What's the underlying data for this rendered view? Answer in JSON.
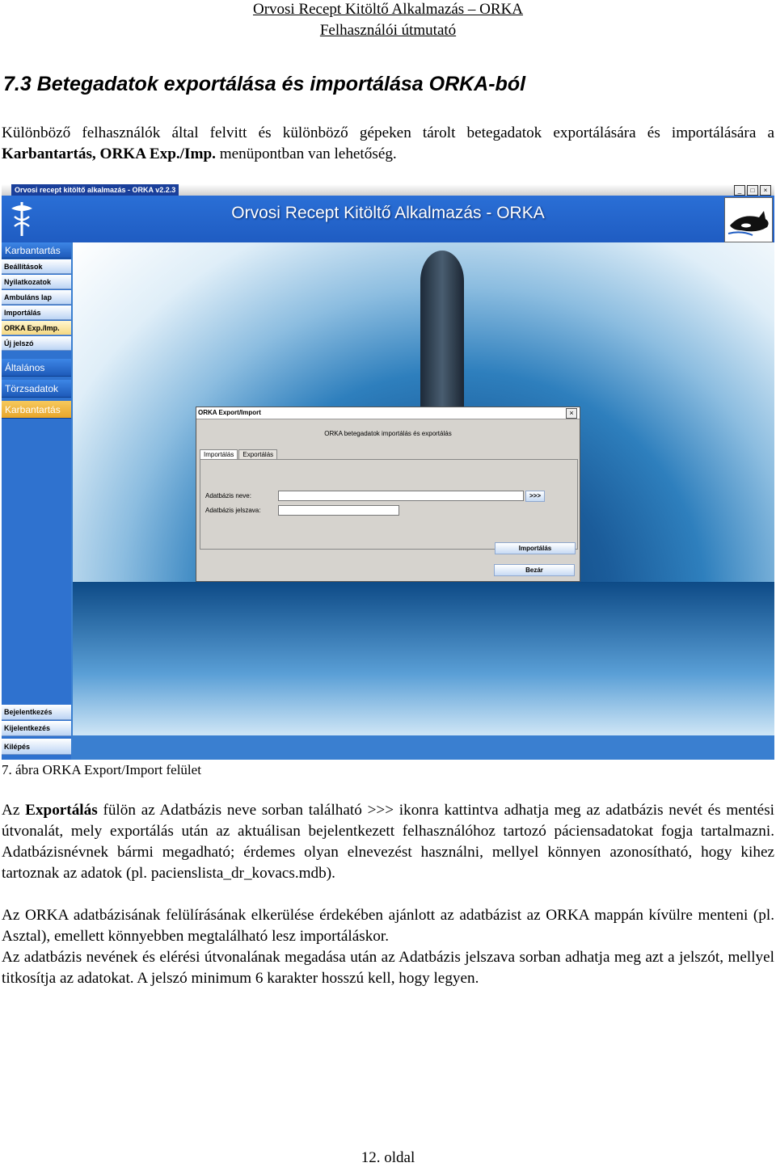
{
  "header": {
    "line1": "Orvosi Recept Kitöltő Alkalmazás – ORKA",
    "line2": "Felhasználói útmutató"
  },
  "section_title": "7.3 Betegadatok exportálása és importálása ORKA-ból",
  "intro": {
    "text_a": "Különböző felhasználók által felvitt és különböző gépeken tárolt betegadatok exportálására és importálására a ",
    "bold": "Karbantartás, ORKA Exp./Imp.",
    "text_b": " menüpontban van lehetőség."
  },
  "screenshot": {
    "window_title": "Orvosi recept kitöltő alkalmazás - ORKA v2.2.3",
    "window_buttons": [
      "_",
      "□",
      "×"
    ],
    "banner_title": "Orvosi Recept Kitöltő Alkalmazás - ORKA",
    "sidebar": {
      "head": "Karbantartás",
      "items": [
        "Beállítások",
        "Nyilatkozatok",
        "Ambuláns lap",
        "Importálás",
        "ORKA Exp./Imp.",
        "Új jelszó"
      ],
      "groups": [
        "Általános",
        "Törzsadatok",
        "Karbantartás"
      ],
      "bottom": [
        "Bejelentkezés",
        "Kijelentkezés",
        "Kilépés"
      ]
    },
    "dialog": {
      "title": "ORKA Export/Import",
      "close": "×",
      "subtitle": "ORKA betegadatok importálás és exportálás",
      "tabs": [
        "Importálás",
        "Exportálás"
      ],
      "db_name_label": "Adatbázis neve:",
      "db_pass_label": "Adatbázis jelszava:",
      "db_name_value": "",
      "db_pass_value": "",
      "browse_label": ">>>",
      "import_button": "Importálás",
      "close_button": "Bezár"
    }
  },
  "caption": "7. ábra ORKA Export/Import felület",
  "body": {
    "p1_a": "Az ",
    "p1_bold": "Exportálás",
    "p1_b": " fülön az Adatbázis neve sorban található >>> ikonra kattintva adhatja meg az adatbázis nevét és mentési útvonalát, mely exportálás után az aktuálisan bejelentkezett felhasználóhoz tartozó páciensadatokat fogja tartalmazni. Adatbázisnévnek bármi megadható; érdemes olyan elnevezést használni, mellyel könnyen azonosítható, hogy kihez tartoznak az adatok (pl. pacienslista_dr_kovacs.mdb).",
    "p2": "Az ORKA adatbázisának felülírásának elkerülése érdekében ajánlott az adatbázist az ORKA mappán kívülre menteni (pl. Asztal), emellett könnyebben megtalálható lesz importáláskor.",
    "p3": "Az adatbázis nevének és elérési útvonalának megadása után az Adatbázis jelszava sorban adhatja meg azt a jelszót, mellyel titkosítja az adatokat. A jelszó minimum 6 karakter hosszú kell, hogy legyen."
  },
  "footer": "12. oldal",
  "icons": {
    "app_logo": "caduceus-logo-icon",
    "orca_logo": "orca-icon"
  }
}
